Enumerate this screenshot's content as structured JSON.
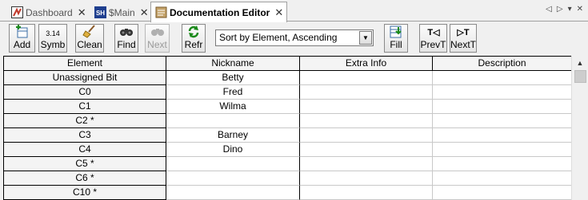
{
  "tabs": [
    {
      "label": "Dashboard",
      "icon": "dashboard-icon",
      "active": false
    },
    {
      "label": "$Main",
      "icon": "sh-ladder-icon",
      "active": false
    },
    {
      "label": "Documentation Editor",
      "icon": "documentation-icon",
      "active": true
    }
  ],
  "tab_close_glyph": "✕",
  "tab_nav": {
    "prev": "◁",
    "next": "▷",
    "menu": "▾",
    "close": "✕"
  },
  "toolbar": {
    "add": "Add",
    "symb": "Symb",
    "clean": "Clean",
    "find": "Find",
    "next": "Next",
    "refr": "Refr",
    "sort_value": "Sort by Element, Ascending",
    "fill": "Fill",
    "prevt": "PrevT",
    "nextt": "NextT",
    "symb_icon_text": "3.14",
    "prevt_icon_text": "T◁",
    "nextt_icon_text": "▷T"
  },
  "grid": {
    "columns": [
      "Element",
      "Nickname",
      "Extra Info",
      "Description"
    ],
    "rows": [
      {
        "element": "Unassigned Bit",
        "nickname": "Betty",
        "extra": "",
        "description": ""
      },
      {
        "element": "C0",
        "nickname": "Fred",
        "extra": "",
        "description": ""
      },
      {
        "element": "C1",
        "nickname": "Wilma",
        "extra": "",
        "description": ""
      },
      {
        "element": "C2 *",
        "nickname": "",
        "extra": "",
        "description": ""
      },
      {
        "element": "C3",
        "nickname": "Barney",
        "extra": "",
        "description": ""
      },
      {
        "element": "C4",
        "nickname": "Dino",
        "extra": "",
        "description": ""
      },
      {
        "element": "C5 *",
        "nickname": "",
        "extra": "",
        "description": ""
      },
      {
        "element": "C6 *",
        "nickname": "",
        "extra": "",
        "description": ""
      },
      {
        "element": "C10 *",
        "nickname": "",
        "extra": "",
        "description": ""
      }
    ]
  },
  "scroll_up_glyph": "▲"
}
